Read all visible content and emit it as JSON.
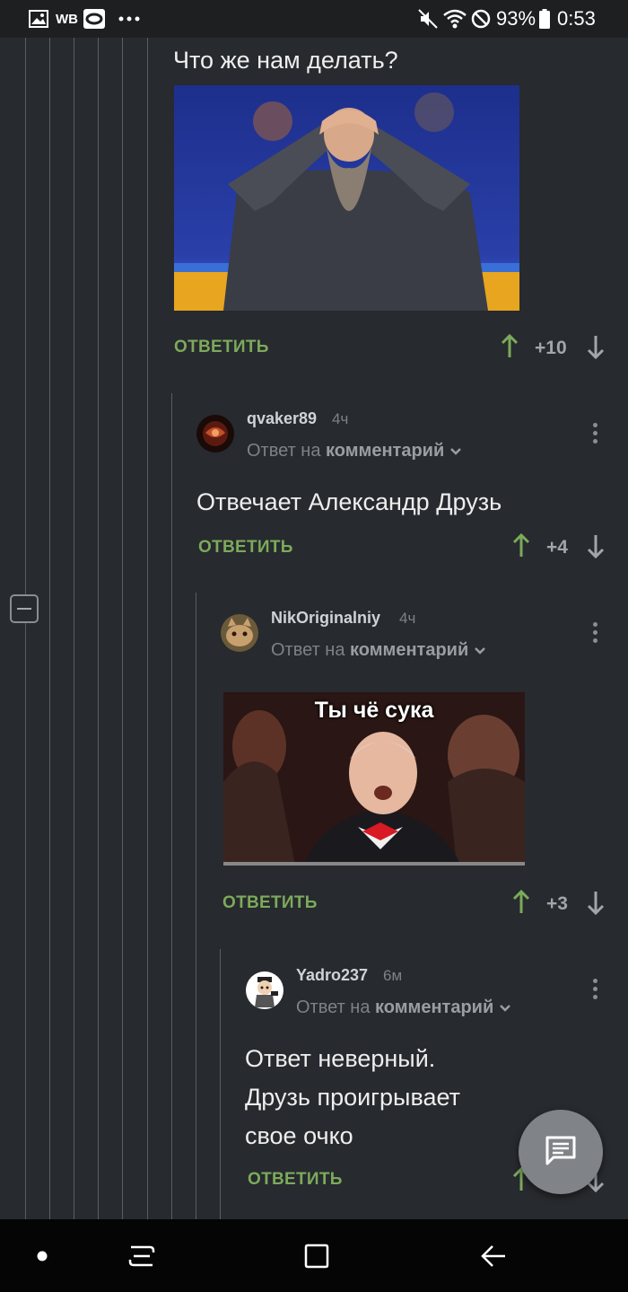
{
  "status_bar": {
    "carrier_label": "WB",
    "battery_percent": "93%",
    "time": "0:53",
    "icons": [
      "gallery-icon",
      "notification-icon",
      "more-icon",
      "mute-icon",
      "wifi-icon",
      "dnd-icon",
      "battery-icon"
    ]
  },
  "comments": [
    {
      "text": "Что же нам делать?",
      "has_image": true,
      "image_desc_icon": "meme-image",
      "reply_label": "ОТВЕТИТЬ",
      "score": "+10"
    },
    {
      "username": "qvaker89",
      "time": "4ч",
      "reply_prefix": "Ответ на",
      "reply_target": "комментарий",
      "text": "Отвечает Александр Друзь",
      "reply_label": "ОТВЕТИТЬ",
      "score": "+4"
    },
    {
      "username": "NikOriginalniy",
      "time": "4ч",
      "reply_prefix": "Ответ на",
      "reply_target": "комментарий",
      "image_caption": "Ты чё сука",
      "reply_label": "ОТВЕТИТЬ",
      "score": "+3"
    },
    {
      "username": "Yadro237",
      "time": "6м",
      "reply_prefix": "Ответ на",
      "reply_target": "комментарий",
      "text_lines": [
        "Ответ неверный.",
        "Друзь проигрывает",
        "свое очко"
      ],
      "reply_label": "ОТВЕТИТЬ"
    }
  ],
  "colors": {
    "background": "#272a2e",
    "accent_green": "#7caa5b",
    "thread_line": "#5a5e63"
  }
}
